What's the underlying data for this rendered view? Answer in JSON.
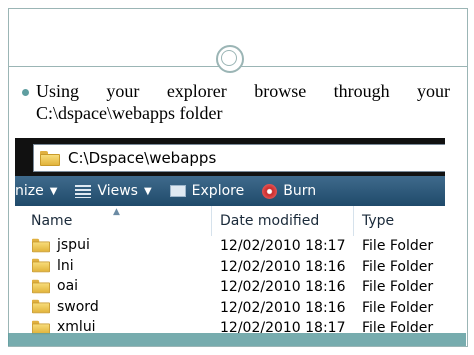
{
  "slide": {
    "bullet_line1": "Using your explorer browse through your",
    "bullet_line2": "C:\\dspace\\webapps folder"
  },
  "explorer": {
    "address": "C:\\Dspace\\webapps",
    "toolbar": {
      "organize_label": "nize",
      "views_label": "Views",
      "explore_label": "Explore",
      "burn_label": "Burn"
    },
    "columns": {
      "name": "Name",
      "date": "Date modified",
      "type": "Type"
    },
    "rows": [
      {
        "name": "jspui",
        "date": "12/02/2010 18:17",
        "type": "File Folder"
      },
      {
        "name": "lni",
        "date": "12/02/2010 18:16",
        "type": "File Folder"
      },
      {
        "name": "oai",
        "date": "12/02/2010 18:16",
        "type": "File Folder"
      },
      {
        "name": "sword",
        "date": "12/02/2010 18:16",
        "type": "File Folder"
      },
      {
        "name": "xmlui",
        "date": "12/02/2010 18:17",
        "type": "File Folder"
      }
    ]
  },
  "colors": {
    "accent": "#5f9ea0",
    "toolbar": "#2b5878"
  }
}
